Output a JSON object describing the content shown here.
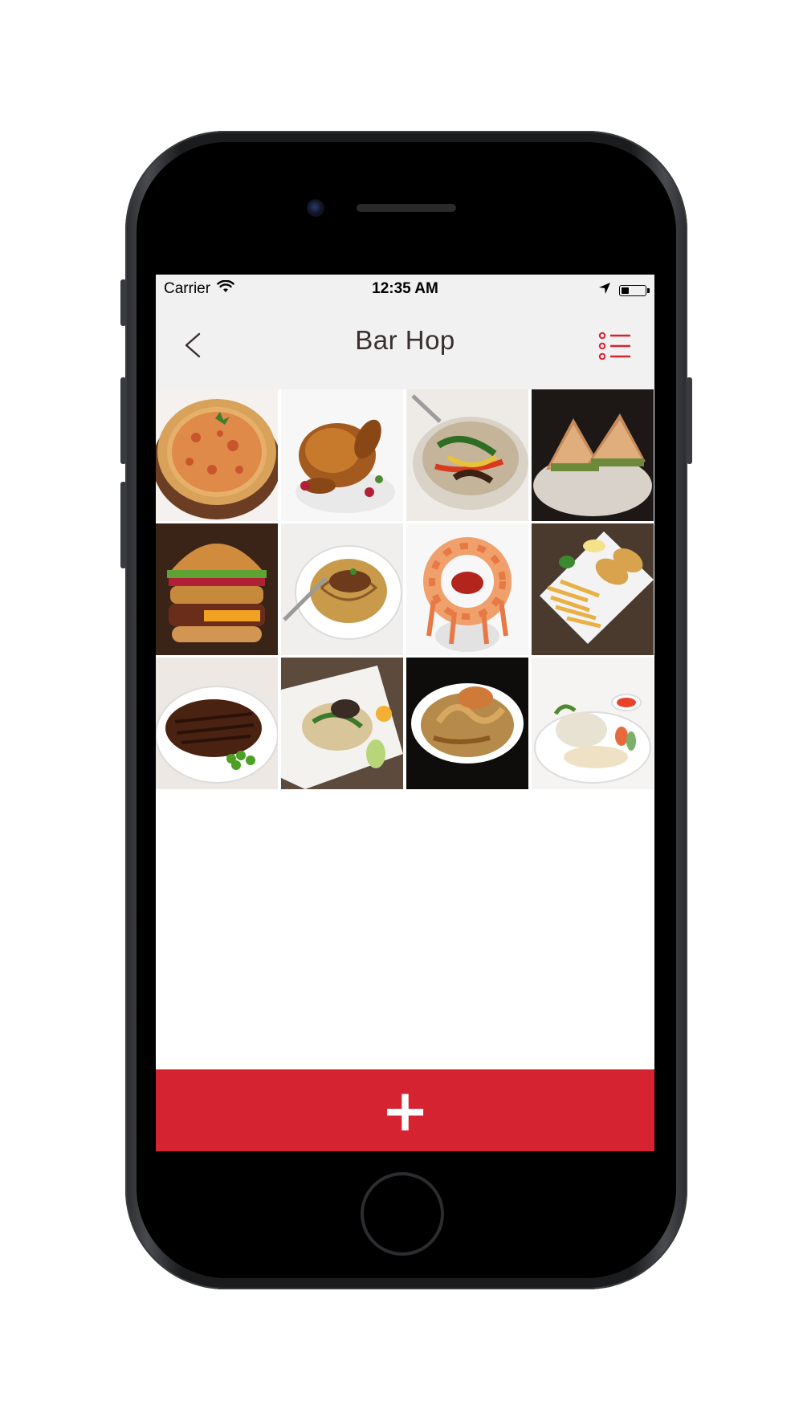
{
  "status_bar": {
    "carrier": "Carrier",
    "time": "12:35 AM",
    "battery_level": 0.35,
    "icons": [
      "wifi-icon",
      "location-arrow-icon",
      "battery-icon"
    ]
  },
  "nav": {
    "title": "Bar Hop",
    "back_icon": "chevron-left-icon",
    "list_icon": "list-icon",
    "accent_color": "#d52331"
  },
  "photos": [
    {
      "subject": "pizza"
    },
    {
      "subject": "roast-chicken"
    },
    {
      "subject": "stir-fry"
    },
    {
      "subject": "club-sandwich"
    },
    {
      "subject": "burger"
    },
    {
      "subject": "spaghetti"
    },
    {
      "subject": "shrimp-cocktail"
    },
    {
      "subject": "fish-and-chips"
    },
    {
      "subject": "steak"
    },
    {
      "subject": "seafood-noodles"
    },
    {
      "subject": "prawn-dish"
    },
    {
      "subject": "chicken-rice"
    }
  ],
  "add_button": {
    "glyph": "+",
    "color": "#d52331"
  }
}
